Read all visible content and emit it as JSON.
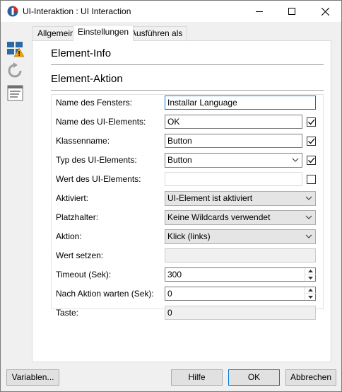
{
  "window": {
    "title": "UI-Interaktion : UI Interaction"
  },
  "titlebar_buttons": {
    "minimize": "minimize-icon",
    "maximize": "maximize-icon",
    "close": "close-icon"
  },
  "sidebar": {
    "icons": [
      "layout-warning-icon",
      "undo-icon",
      "list-view-icon"
    ]
  },
  "tabs": [
    {
      "label": "Allgemein",
      "active": false
    },
    {
      "label": "Einstellungen",
      "active": true
    },
    {
      "label": "Ausführen als",
      "active": false
    }
  ],
  "sections": {
    "info_title": "Element-Info",
    "action_title": "Element-Aktion"
  },
  "form": {
    "window_name": {
      "label": "Name des Fensters:",
      "value": "Installar Language"
    },
    "element_name": {
      "label": "Name des UI-Elements:",
      "value": "OK",
      "checked": true
    },
    "class_name": {
      "label": "Klassenname:",
      "value": "Button",
      "checked": true
    },
    "element_type": {
      "label": "Typ des UI-Elements:",
      "value": "Button",
      "checked": true
    },
    "element_value": {
      "label": "Wert des UI-Elements:",
      "value": "",
      "checked": false
    },
    "activated": {
      "label": "Aktiviert:",
      "value": "UI-Element ist aktiviert"
    },
    "placeholder": {
      "label": "Platzhalter:",
      "value": "Keine Wildcards verwendet"
    },
    "action": {
      "label": "Aktion:",
      "value": "Klick (links)"
    },
    "set_value": {
      "label": "Wert setzen:",
      "value": ""
    },
    "timeout": {
      "label": "Timeout (Sek):",
      "value": "300"
    },
    "wait_after": {
      "label": "Nach Aktion warten (Sek):",
      "value": "0"
    },
    "key": {
      "label": "Taste:",
      "value": "0"
    }
  },
  "buttons": {
    "variables": "Variablen...",
    "help": "Hilfe",
    "ok": "OK",
    "cancel": "Abbrechen"
  },
  "colors": {
    "accent": "#0078d7",
    "warning": "#f0a30a",
    "icon_blue": "#2a6aa8"
  }
}
